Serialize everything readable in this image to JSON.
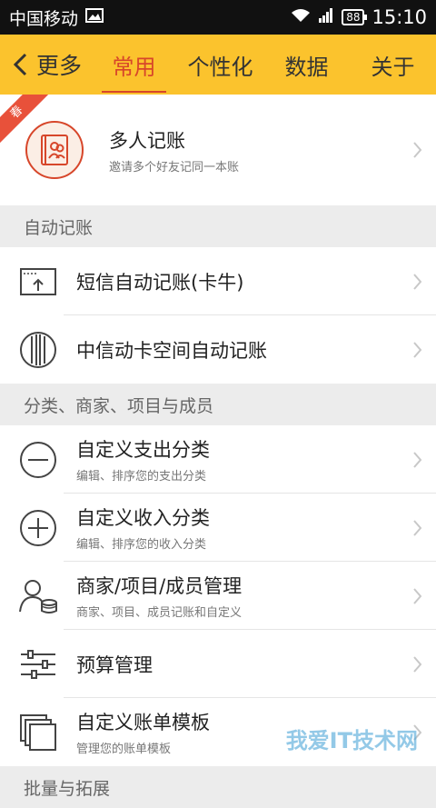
{
  "status_bar": {
    "carrier": "中国移动",
    "battery": "88",
    "time": "15:10"
  },
  "header": {
    "back_label": "更多",
    "tabs": [
      {
        "label": "常用",
        "active": true
      },
      {
        "label": "个性化",
        "active": false
      },
      {
        "label": "数据",
        "active": false
      },
      {
        "label": "关于",
        "active": false
      }
    ]
  },
  "multi_book": {
    "badge": "春",
    "title": "多人记账",
    "subtitle": "邀请多个好友记同一本账"
  },
  "sections": {
    "auto": "自动记账",
    "categories": "分类、商家、项目与成员",
    "next_partial": "批量与拓展"
  },
  "auto_items": [
    {
      "title": "短信自动记账(卡牛)",
      "icon": "sms-icon"
    },
    {
      "title": "中信动卡空间自动记账",
      "icon": "citic-bank-icon"
    }
  ],
  "category_items": [
    {
      "title": "自定义支出分类",
      "subtitle": "编辑、排序您的支出分类",
      "icon": "minus-circle-icon"
    },
    {
      "title": "自定义收入分类",
      "subtitle": "编辑、排序您的收入分类",
      "icon": "plus-circle-icon"
    },
    {
      "title": "商家/项目/成员管理",
      "subtitle": "商家、项目、成员记账和自定义",
      "icon": "member-coins-icon"
    },
    {
      "title": "预算管理",
      "subtitle": "",
      "icon": "sliders-icon"
    },
    {
      "title": "自定义账单模板",
      "subtitle": "管理您的账单模板",
      "icon": "template-icon"
    }
  ],
  "watermark": "我爱IT技术网",
  "colors": {
    "header_bg": "#fbc32d",
    "active_tab": "#d7462a",
    "ribbon": "#e8513a"
  }
}
